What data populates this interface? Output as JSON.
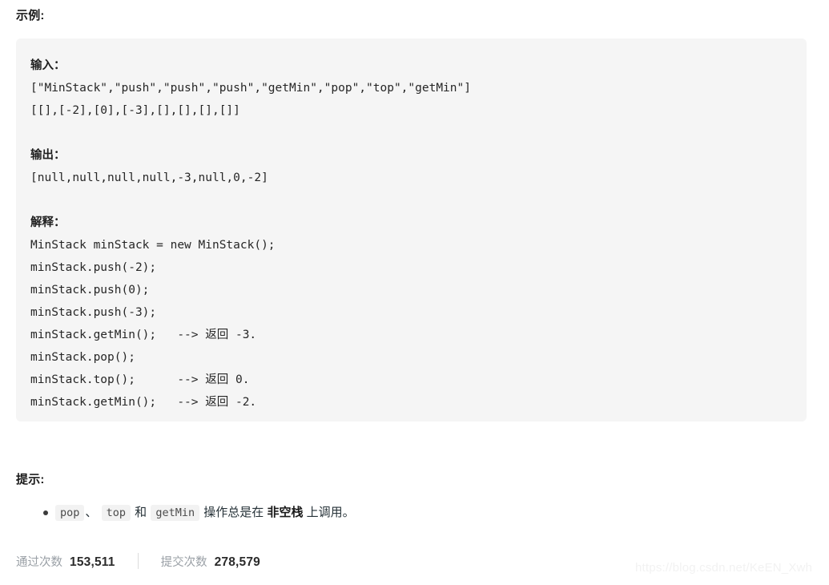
{
  "example": {
    "heading": "示例:",
    "code_lines": [
      {
        "kind": "label",
        "text": "输入："
      },
      {
        "kind": "code",
        "text": "[\"MinStack\",\"push\",\"push\",\"push\",\"getMin\",\"pop\",\"top\",\"getMin\"]"
      },
      {
        "kind": "code",
        "text": "[[],[-2],[0],[-3],[],[],[],[]]"
      },
      {
        "kind": "spacer",
        "text": ""
      },
      {
        "kind": "label",
        "text": "输出："
      },
      {
        "kind": "code",
        "text": "[null,null,null,null,-3,null,0,-2]"
      },
      {
        "kind": "spacer",
        "text": ""
      },
      {
        "kind": "label",
        "text": "解释："
      },
      {
        "kind": "code",
        "text": "MinStack minStack = new MinStack();"
      },
      {
        "kind": "code",
        "text": "minStack.push(-2);"
      },
      {
        "kind": "code",
        "text": "minStack.push(0);"
      },
      {
        "kind": "code",
        "text": "minStack.push(-3);"
      },
      {
        "kind": "code",
        "text": "minStack.getMin();   --> 返回 -3."
      },
      {
        "kind": "code",
        "text": "minStack.pop();"
      },
      {
        "kind": "code",
        "text": "minStack.top();      --> 返回 0."
      },
      {
        "kind": "code",
        "text": "minStack.getMin();   --> 返回 -2."
      }
    ]
  },
  "hints": {
    "heading": "提示:",
    "items": [
      {
        "code1": "pop",
        "sep1": "、",
        "code2": "top",
        "sep2": "和",
        "code3": "getMin",
        "text_before_strong": "操作总是在",
        "strong": "非空栈",
        "text_after_strong": "上调用。"
      }
    ]
  },
  "stats": {
    "accepted_label": "通过次数",
    "accepted_value": "153,511",
    "submissions_label": "提交次数",
    "submissions_value": "278,579"
  },
  "watermark": {
    "text": "https://blog.csdn.net/KeEN_Xwh"
  },
  "colors": {
    "code_block_bg": "#f5f5f5",
    "inline_code_bg": "#f2f2f2",
    "text": "#263238",
    "muted_label": "#9aa0a6",
    "watermark": "#f2f2f2"
  }
}
